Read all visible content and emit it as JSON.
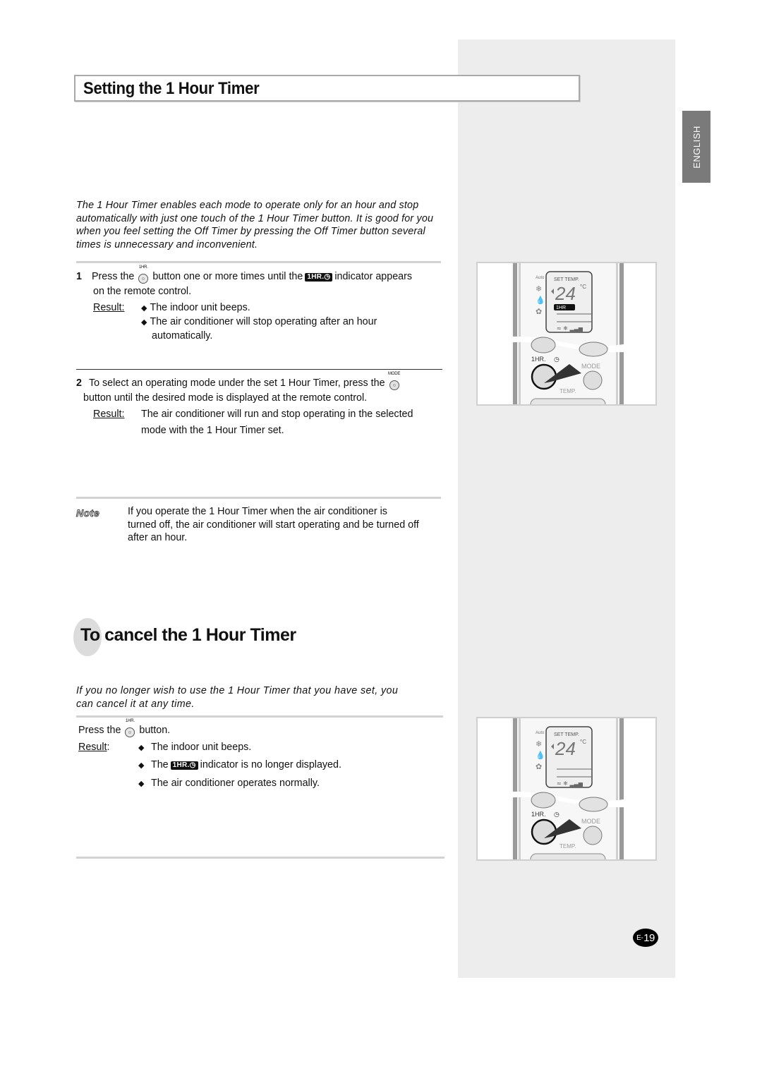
{
  "page": {
    "language_tab": "ENGLISH",
    "page_number_prefix": "E-",
    "page_number": "19"
  },
  "section1": {
    "title": "Setting the 1 Hour Timer",
    "intro": "The 1 Hour Timer enables each mode to operate only for an hour and stop automatically with just one touch of the 1 Hour Timer button. It is good for you when you feel setting the Off Timer by pressing the Off Timer button several times is unnecessary and inconvenient.",
    "steps": [
      {
        "number": "1",
        "text_before_button": "Press the",
        "button_label": "1HR.",
        "text_after_button": "button one or more times until the",
        "indicator_label": "1HR.",
        "text_after_indicator": "indicator appears",
        "text_line2": "on the remote control.",
        "result_label": "Result:",
        "results": [
          "The indoor unit beeps.",
          "The air conditioner will stop operating after an hour",
          "automatically."
        ]
      },
      {
        "number": "2",
        "text_before_button": "To select an operating mode under the set 1 Hour Timer, press the",
        "button_label": "MODE",
        "text_line2": "button until the desired mode is displayed at the remote control.",
        "result_label": "Result:",
        "result_text_line1": "The air conditioner will run and stop operating in the selected",
        "result_text_line2": "mode with the 1 Hour Timer set."
      }
    ],
    "note": {
      "label": "Note",
      "line1": "If you operate the 1 Hour Timer when the air conditioner is",
      "line2": "turned off, the air conditioner will start operating and be turned off",
      "line3": "after an hour."
    }
  },
  "section2": {
    "title": "To cancel the 1 Hour Timer",
    "intro_line1": "If you no longer wish to use the 1 Hour Timer that you have set, you",
    "intro_line2": "can cancel it at any time.",
    "press_text": "Press the",
    "button_label": "1HR.",
    "press_after": "button.",
    "result_label": "Result",
    "result_colon": ":",
    "results": [
      {
        "text": "The indoor unit beeps."
      },
      {
        "before": "The",
        "indicator": "1HR.",
        "after": "indicator is no longer displayed."
      },
      {
        "text": "The air conditioner operates normally."
      }
    ]
  },
  "figures": {
    "remote1": {
      "set_temp_label": "SET TEMP.",
      "temperature": "24",
      "unit": "°C",
      "indicator": "1HR",
      "indicator_shown": true,
      "button_1hr_label": "1HR.",
      "button_mode_label": "MODE",
      "button_temp_label": "TEMP.",
      "auto_label": "Auto"
    },
    "remote2": {
      "set_temp_label": "SET TEMP.",
      "temperature": "24",
      "unit": "°C",
      "indicator_shown": false,
      "button_1hr_label": "1HR.",
      "button_mode_label": "MODE",
      "button_temp_label": "TEMP.",
      "auto_label": "Auto"
    }
  }
}
